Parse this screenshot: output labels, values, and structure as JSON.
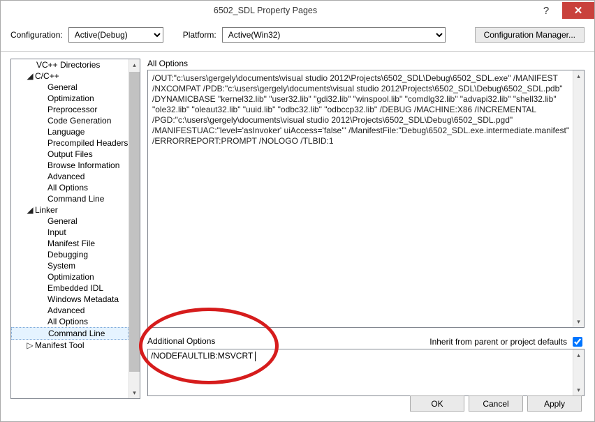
{
  "titlebar": {
    "title": "6502_SDL Property Pages"
  },
  "config": {
    "config_label": "Configuration:",
    "config_value": "Active(Debug)",
    "platform_label": "Platform:",
    "platform_value": "Active(Win32)",
    "manager_label": "Configuration Manager..."
  },
  "tree": [
    {
      "label": "VC++ Directories",
      "indent": 1
    },
    {
      "label": "C/C++",
      "indent": 1,
      "expander": "◢"
    },
    {
      "label": "General",
      "indent": 2
    },
    {
      "label": "Optimization",
      "indent": 2
    },
    {
      "label": "Preprocessor",
      "indent": 2
    },
    {
      "label": "Code Generation",
      "indent": 2
    },
    {
      "label": "Language",
      "indent": 2
    },
    {
      "label": "Precompiled Headers",
      "indent": 2
    },
    {
      "label": "Output Files",
      "indent": 2
    },
    {
      "label": "Browse Information",
      "indent": 2
    },
    {
      "label": "Advanced",
      "indent": 2
    },
    {
      "label": "All Options",
      "indent": 2
    },
    {
      "label": "Command Line",
      "indent": 2
    },
    {
      "label": "Linker",
      "indent": 1,
      "expander": "◢"
    },
    {
      "label": "General",
      "indent": 2
    },
    {
      "label": "Input",
      "indent": 2
    },
    {
      "label": "Manifest File",
      "indent": 2
    },
    {
      "label": "Debugging",
      "indent": 2
    },
    {
      "label": "System",
      "indent": 2
    },
    {
      "label": "Optimization",
      "indent": 2
    },
    {
      "label": "Embedded IDL",
      "indent": 2
    },
    {
      "label": "Windows Metadata",
      "indent": 2
    },
    {
      "label": "Advanced",
      "indent": 2
    },
    {
      "label": "All Options",
      "indent": 2
    },
    {
      "label": "Command Line",
      "indent": 2,
      "selected": true
    },
    {
      "label": "Manifest Tool",
      "indent": 1,
      "expander": "▷"
    }
  ],
  "right": {
    "all_options_label": "All Options",
    "all_options_text": "/OUT:\"c:\\users\\gergely\\documents\\visual studio 2012\\Projects\\6502_SDL\\Debug\\6502_SDL.exe\" /MANIFEST /NXCOMPAT /PDB:\"c:\\users\\gergely\\documents\\visual studio 2012\\Projects\\6502_SDL\\Debug\\6502_SDL.pdb\" /DYNAMICBASE \"kernel32.lib\" \"user32.lib\" \"gdi32.lib\" \"winspool.lib\" \"comdlg32.lib\" \"advapi32.lib\" \"shell32.lib\" \"ole32.lib\" \"oleaut32.lib\" \"uuid.lib\" \"odbc32.lib\" \"odbccp32.lib\" /DEBUG /MACHINE:X86 /INCREMENTAL /PGD:\"c:\\users\\gergely\\documents\\visual studio 2012\\Projects\\6502_SDL\\Debug\\6502_SDL.pgd\" /MANIFESTUAC:\"level='asInvoker' uiAccess='false'\" /ManifestFile:\"Debug\\6502_SDL.exe.intermediate.manifest\" /ERRORREPORT:PROMPT /NOLOGO /TLBID:1 ",
    "additional_label": "Additional Options",
    "inherit_label": "Inherit from parent or project defaults",
    "inherit_checked": true,
    "additional_value": "/NODEFAULTLIB:MSVCRT "
  },
  "buttons": {
    "ok": "OK",
    "cancel": "Cancel",
    "apply": "Apply"
  }
}
